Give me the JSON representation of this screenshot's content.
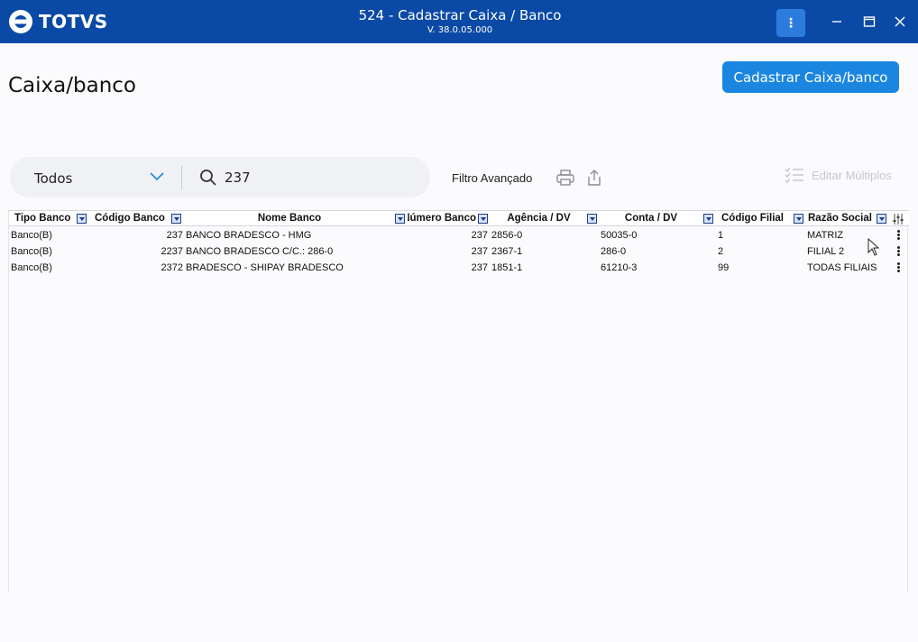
{
  "app": {
    "logo_text": "TOTVS",
    "title": "524 - Cadastrar Caixa / Banco",
    "version": "V. 38.0.05.000",
    "menu_glyph": "⋮"
  },
  "page": {
    "title": "Caixa/banco",
    "primary_button": "Cadastrar Caixa/banco"
  },
  "filters": {
    "type_selected": "Todos",
    "search_value": "237",
    "advanced_filter": "Filtro Avançado",
    "edit_multiple": "Editar Múltiplos"
  },
  "grid": {
    "columns": [
      "Tipo Banco",
      "Código Banco",
      "Nome Banco",
      "Número Banco",
      "Agência / DV",
      "Conta / DV",
      "Código Filial",
      "Razão Social"
    ],
    "rows": [
      [
        "Banco(B)",
        "237",
        "BANCO BRADESCO - HMG",
        "237",
        "2856-0",
        "50035-0",
        "1",
        "MATRIZ"
      ],
      [
        "Banco(B)",
        "2237",
        "BANCO BRADESCO C/C.: 286-0",
        "237",
        "2367-1",
        "286-0",
        "2",
        "FILIAL 2"
      ],
      [
        "Banco(B)",
        "2372",
        "BRADESCO - SHIPAY BRADESCO",
        "237",
        "1851-1",
        "61210-3",
        "99",
        "TODAS FILIAIS"
      ]
    ]
  },
  "colors": {
    "titlebar": "#0a4aa6",
    "primary": "#1a86e0",
    "menu_button": "#2e7be0"
  },
  "icons": [
    "totvs-logo-icon",
    "kebab-icon",
    "minimize-icon",
    "maximize-icon",
    "close-icon",
    "chevron-down-icon",
    "search-icon",
    "print-icon",
    "export-icon",
    "edit-multiple-icon",
    "filter-icon",
    "column-settings-icon",
    "row-actions-icon",
    "mouse-cursor-icon"
  ]
}
